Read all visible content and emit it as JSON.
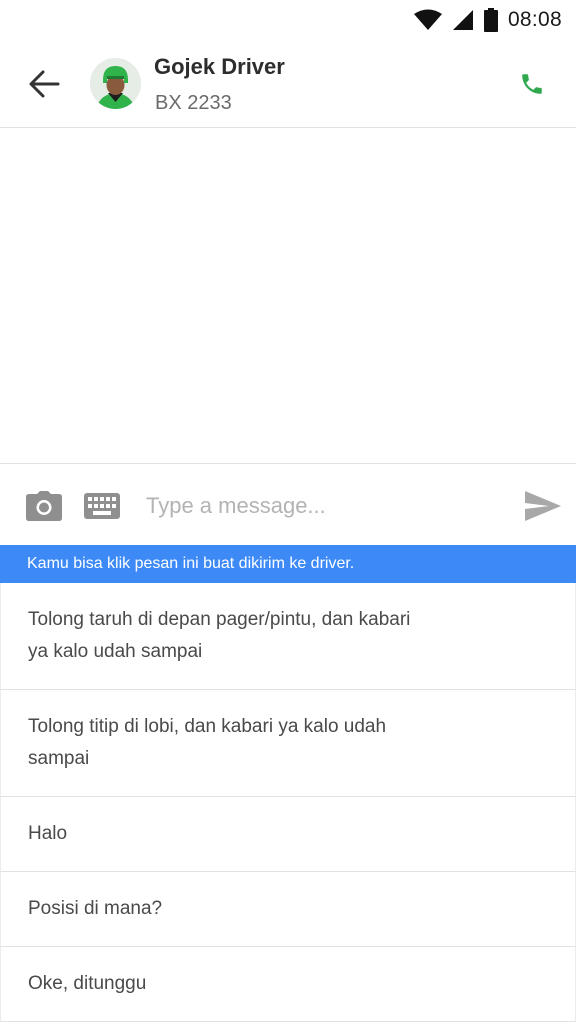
{
  "status_bar": {
    "time": "08:08",
    "icons": [
      "wifi-icon",
      "signal-icon",
      "battery-icon"
    ]
  },
  "header": {
    "back_icon": "arrow-left-icon",
    "driver_name": "Gojek Driver",
    "plate_number": "BX 2233",
    "call_icon": "phone-icon",
    "call_icon_color": "#2fa84f"
  },
  "composer": {
    "camera_icon": "camera-icon",
    "keyboard_icon": "keyboard-icon",
    "placeholder": "Type a message...",
    "send_icon": "send-icon"
  },
  "hint": {
    "text": "Kamu bisa klik pesan ini buat dikirim ke driver.",
    "color": "#3d8af7"
  },
  "quick_replies": [
    "Tolong taruh di depan pager/pintu, dan kabari ya kalo udah sampai",
    "Tolong titip di lobi, dan kabari ya kalo udah sampai",
    "Halo",
    "Posisi di mana?",
    "Oke, ditunggu"
  ]
}
